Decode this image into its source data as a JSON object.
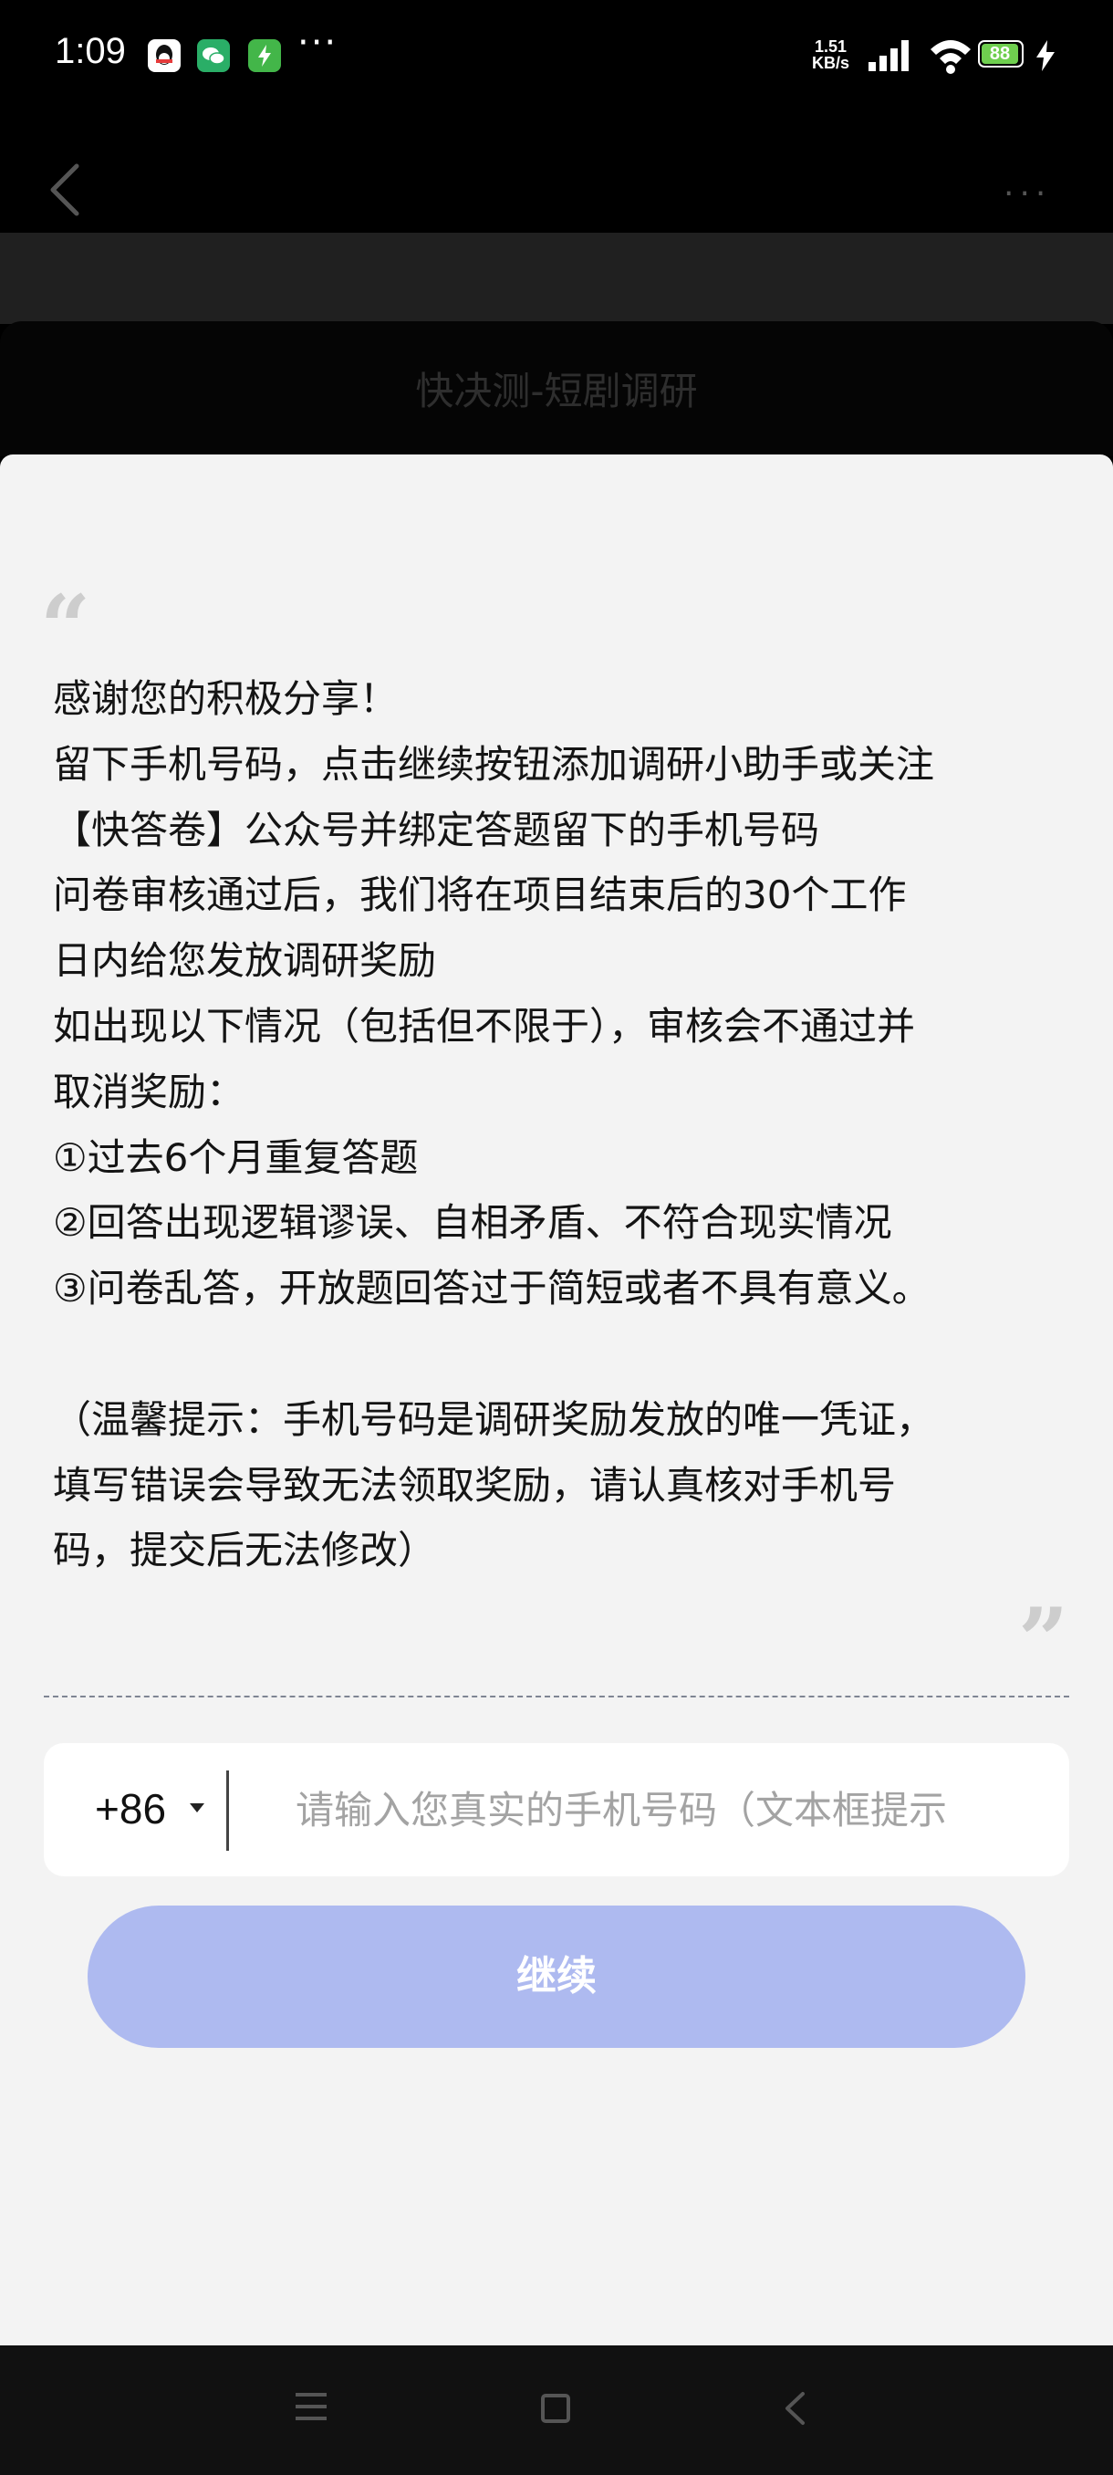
{
  "status_bar": {
    "time": "1:09",
    "more": "···",
    "net_speed_value": "1.51",
    "net_speed_unit": "KB/s",
    "battery": "88",
    "icons": [
      "qq-icon",
      "wechat-icon",
      "charging-app-icon",
      "signal-icon",
      "wifi-icon",
      "battery-icon",
      "charging-bolt-icon"
    ],
    "colors": {
      "qq": "#ffffff",
      "wechat": "#2aae67",
      "charging_app": "#43b649",
      "battery_fill": "#6fcf4f"
    }
  },
  "header": {
    "title": "快决测-短剧调研",
    "more": "···"
  },
  "notice": {
    "lines": [
      "感谢您的积极分享！",
      "留下手机号码，点击继续按钮添加调研小助手或关注",
      "【快答卷】公众号并绑定答题留下的手机号码",
      "问卷审核通过后，我们将在项目结束后的30个工作",
      "日内给您发放调研奖励",
      "如出现以下情况（包括但不限于），审核会不通过并",
      "取消奖励：",
      "①过去6个月重复答题",
      "②回答出现逻辑谬误、自相矛盾、不符合现实情况",
      "③问卷乱答，开放题回答过于简短或者不具有意义。",
      "",
      "（温馨提示：手机号码是调研奖励发放的唯一凭证，",
      "填写错误会导致无法领取奖励，请认真核对手机号",
      "码，提交后无法修改）"
    ],
    "quote_open": "“",
    "quote_close": "”"
  },
  "phone": {
    "country_code": "+86",
    "placeholder": "请输入您真实的手机号码（文本框提示",
    "value": ""
  },
  "continue_button": {
    "label": "继续",
    "color": "#aebaf0"
  },
  "nav_bar": {
    "icons": [
      "menu-icon",
      "home-square-icon",
      "back-chevron-icon"
    ]
  }
}
